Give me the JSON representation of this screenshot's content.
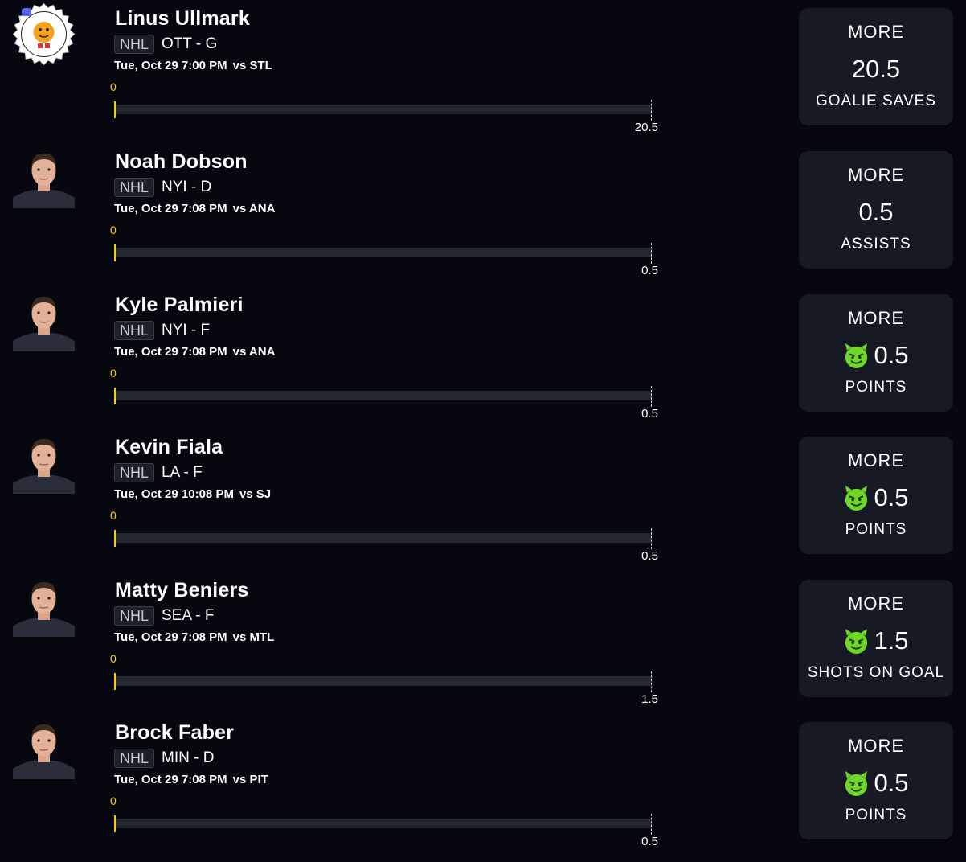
{
  "league_badge": "NHL",
  "colors": {
    "background": "#07080f",
    "card": "#171a24",
    "progress_track": "#252833",
    "zero_marker": "#f5d000",
    "demon": "#6fd62a"
  },
  "picks": [
    {
      "player": "Linus Ullmark",
      "avatar": "discord-voted-badge-icon",
      "league": "NHL",
      "team_pos": "OTT - G",
      "game_time": "Tue, Oct 29 7:00 PM",
      "opponent": "vs STL",
      "progress_start": "0",
      "progress_current": 0,
      "line_label": "20.5",
      "direction": "MORE",
      "line": "20.5",
      "stat": "GOALIE SAVES",
      "demon": false
    },
    {
      "player": "Noah Dobson",
      "avatar": "player-headshot-icon",
      "league": "NHL",
      "team_pos": "NYI - D",
      "game_time": "Tue, Oct 29 7:08 PM",
      "opponent": "vs ANA",
      "progress_start": "0",
      "progress_current": 0,
      "line_label": "0.5",
      "direction": "MORE",
      "line": "0.5",
      "stat": "ASSISTS",
      "demon": false
    },
    {
      "player": "Kyle Palmieri",
      "avatar": "player-headshot-icon",
      "league": "NHL",
      "team_pos": "NYI - F",
      "game_time": "Tue, Oct 29 7:08 PM",
      "opponent": "vs ANA",
      "progress_start": "0",
      "progress_current": 0,
      "line_label": "0.5",
      "direction": "MORE",
      "line": "0.5",
      "stat": "POINTS",
      "demon": true
    },
    {
      "player": "Kevin Fiala",
      "avatar": "player-headshot-icon",
      "league": "NHL",
      "team_pos": "LA - F",
      "game_time": "Tue, Oct 29 10:08 PM",
      "opponent": "vs SJ",
      "progress_start": "0",
      "progress_current": 0,
      "line_label": "0.5",
      "direction": "MORE",
      "line": "0.5",
      "stat": "POINTS",
      "demon": true
    },
    {
      "player": "Matty Beniers",
      "avatar": "player-headshot-icon",
      "league": "NHL",
      "team_pos": "SEA - F",
      "game_time": "Tue, Oct 29 7:08 PM",
      "opponent": "vs MTL",
      "progress_start": "0",
      "progress_current": 0,
      "line_label": "1.5",
      "direction": "MORE",
      "line": "1.5",
      "stat": "SHOTS ON GOAL",
      "demon": true
    },
    {
      "player": "Brock Faber",
      "avatar": "player-headshot-icon",
      "league": "NHL",
      "team_pos": "MIN - D",
      "game_time": "Tue, Oct 29 7:08 PM",
      "opponent": "vs PIT",
      "progress_start": "0",
      "progress_current": 0,
      "line_label": "0.5",
      "direction": "MORE",
      "line": "0.5",
      "stat": "POINTS",
      "demon": true
    }
  ]
}
